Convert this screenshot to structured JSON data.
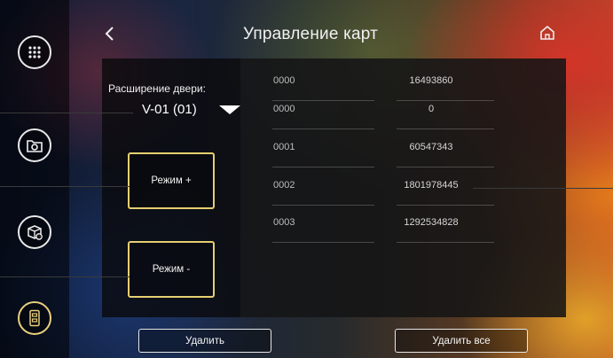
{
  "header": {
    "title": "Управление карт",
    "back_icon": "chevron-left-icon",
    "home_icon": "home-icon"
  },
  "sidebar": {
    "items": [
      {
        "icon": "keypad-icon",
        "active": false
      },
      {
        "icon": "camera-folder-icon",
        "active": false
      },
      {
        "icon": "package-settings-icon",
        "active": false
      },
      {
        "icon": "card-reader-icon",
        "active": true
      }
    ]
  },
  "extension": {
    "label": "Расширение двери:",
    "value": "V-01 (01)"
  },
  "mode_buttons": {
    "plus_label": "Режим +",
    "minus_label": "Режим -"
  },
  "cards": [
    {
      "num": "0000",
      "card": "16493860"
    },
    {
      "num": "0000",
      "card": "0"
    },
    {
      "num": "0001",
      "card": "60547343"
    },
    {
      "num": "0002",
      "card": "1801978445"
    },
    {
      "num": "0003",
      "card": "1292534828"
    }
  ],
  "actions": {
    "delete_label": "Удалить",
    "delete_all_label": "Удалить все"
  },
  "colors": {
    "accent_border": "#e6cf70",
    "panel": "#141416",
    "text": "#f0f0f0"
  }
}
